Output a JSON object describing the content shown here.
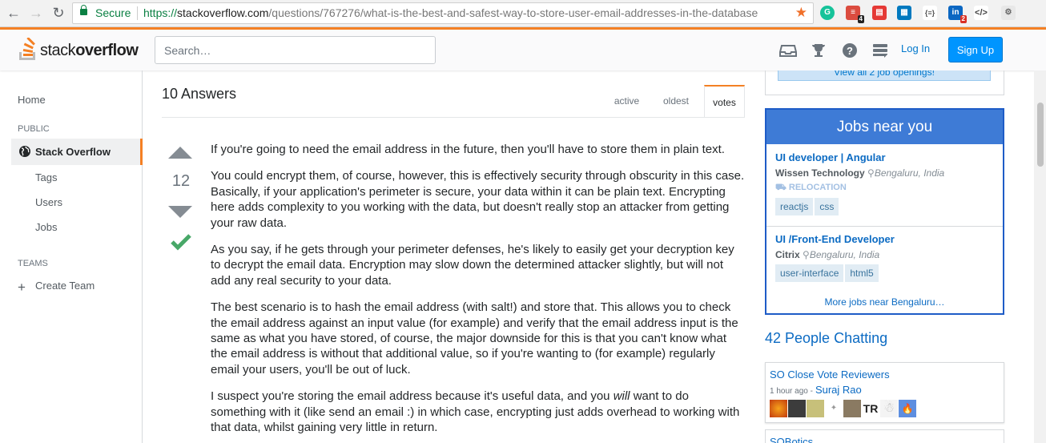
{
  "browser": {
    "secure_label": "Secure",
    "url_scheme": "https://",
    "url_host": "stackoverflow.com",
    "url_path": "/questions/767276/what-is-the-best-and-safest-way-to-store-user-email-addresses-in-the-database",
    "extensions": [
      "grammarly-icon",
      "todoist-icon",
      "pdf-icon",
      "trello-icon",
      "json-icon",
      "linkedin-icon",
      "code-icon",
      "settings-icon"
    ],
    "ext_badges": {
      "todoist": "4",
      "linkedin": "2"
    }
  },
  "header": {
    "logo_text_a": "stack",
    "logo_text_b": "overflow",
    "search_placeholder": "Search…",
    "login_label": "Log In",
    "signup_label": "Sign Up"
  },
  "sidebar": {
    "home": "Home",
    "public_heading": "PUBLIC",
    "active_item": "Stack Overflow",
    "tags": "Tags",
    "users": "Users",
    "jobs": "Jobs",
    "teams_heading": "TEAMS",
    "create_team": "Create Team"
  },
  "answers": {
    "title": "10 Answers",
    "tabs": [
      "active",
      "oldest",
      "votes"
    ],
    "active_tab": "votes",
    "score": "12",
    "paragraphs": [
      "If you're going to need the email address in the future, then you'll have to store them in plain text.",
      "You could encrypt them, of course, however, this is effectively security through obscurity in this case. Basically, if your application's perimeter is secure, your data within it can be plain text. Encrypting here adds complexity to you working with the data, but doesn't really stop an attacker from getting your raw data.",
      "As you say, if he gets through your perimeter defenses, he's likely to easily get your decryption key to decrypt the email data. Encryption may slow down the determined attacker slightly, but will not add any real security to your data.",
      "The best scenario is to hash the email address (with salt!) and store that. This allows you to check the email address against an input value (for example) and verify that the email address input is the same as what you have stored, of course, the major downside for this is that you can't know what the email address is without that additional value, so if you're wanting to (for example) regularly email your users, you'll be out of luck."
    ],
    "last_paragraph_a": "I suspect you're storing the email address because it's useful data, and you ",
    "last_paragraph_em": "will",
    "last_paragraph_b": " want to do something with it (like send an email :) in which case, encrypting just adds overhead to working with that data, whilst gaining very little in return."
  },
  "jobs": {
    "view_all": "View all 2 job openings!",
    "heading": "Jobs near you",
    "items": [
      {
        "title": "UI developer | Angular",
        "company": "Wissen Technology",
        "location": "Bengaluru, India",
        "relocation": "RELOCATION",
        "tags": [
          "reactjs",
          "css"
        ]
      },
      {
        "title": "UI /Front-End Developer",
        "company": "Citrix",
        "location": "Bengaluru, India",
        "tags": [
          "user-interface",
          "html5"
        ]
      }
    ],
    "more": "More jobs near Bengaluru…"
  },
  "chat": {
    "title": "42 People Chatting",
    "room1": "SO Close Vote Reviewers",
    "room1_time": "1 hour ago -",
    "room1_user": "Suraj Rao",
    "room2": "SOBotics"
  }
}
